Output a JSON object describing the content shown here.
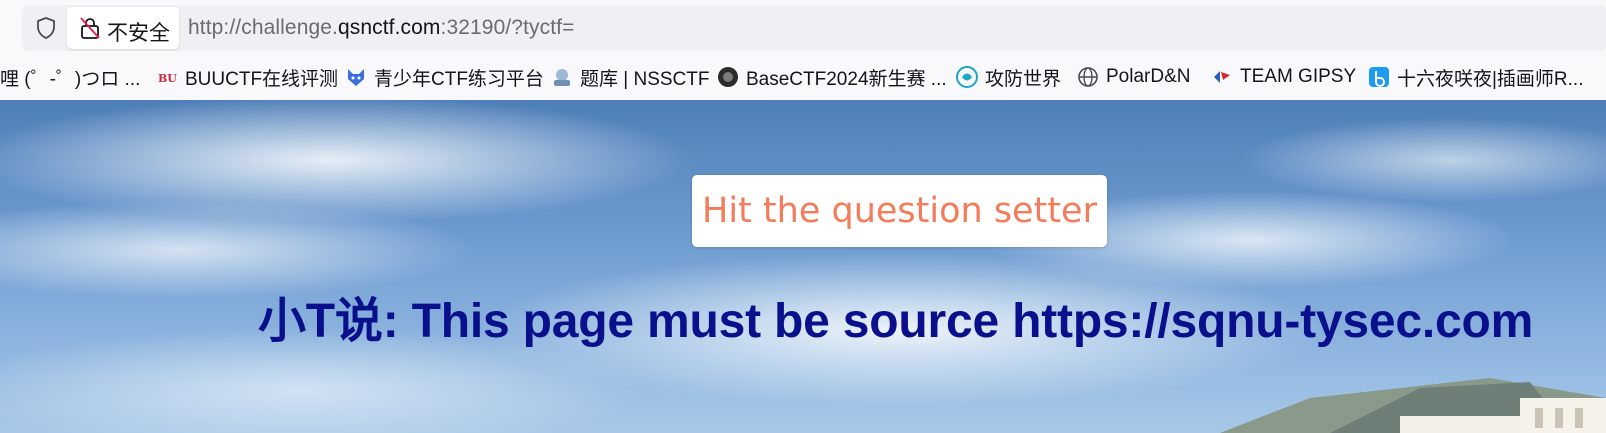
{
  "urlbar": {
    "security_label": "不安全",
    "url_prefix": "http://challenge.",
    "url_host": "qsnctf.com",
    "url_suffix": ":32190/?tyctf="
  },
  "bookmarks": [
    {
      "label": "哩 (゜-゜)つロ ...",
      "icon": "none"
    },
    {
      "label": "BUUCTF在线评测",
      "icon": "buu-icon"
    },
    {
      "label": "青少年CTF练习平台",
      "icon": "wolf-icon"
    },
    {
      "label": "题库 | NSSCTF",
      "icon": "nss-icon"
    },
    {
      "label": "BaseCTF2024新生赛 ...",
      "icon": "basectf-icon"
    },
    {
      "label": "攻防世界",
      "icon": "adworld-icon"
    },
    {
      "label": "PolarD&N",
      "icon": "globe-icon"
    },
    {
      "label": "TEAM GIPSY",
      "icon": "gipsy-icon"
    },
    {
      "label": "十六夜咲夜|插画师R...",
      "icon": "bilibili-icon"
    }
  ],
  "page": {
    "button_label": "Hit the question setter",
    "headline": "小T说: This page must be source https://sqnu-tysec.com"
  },
  "colors": {
    "button_text": "#f47c5a",
    "headline_text": "#0a0f8c",
    "sky": "#6d9bd0"
  }
}
